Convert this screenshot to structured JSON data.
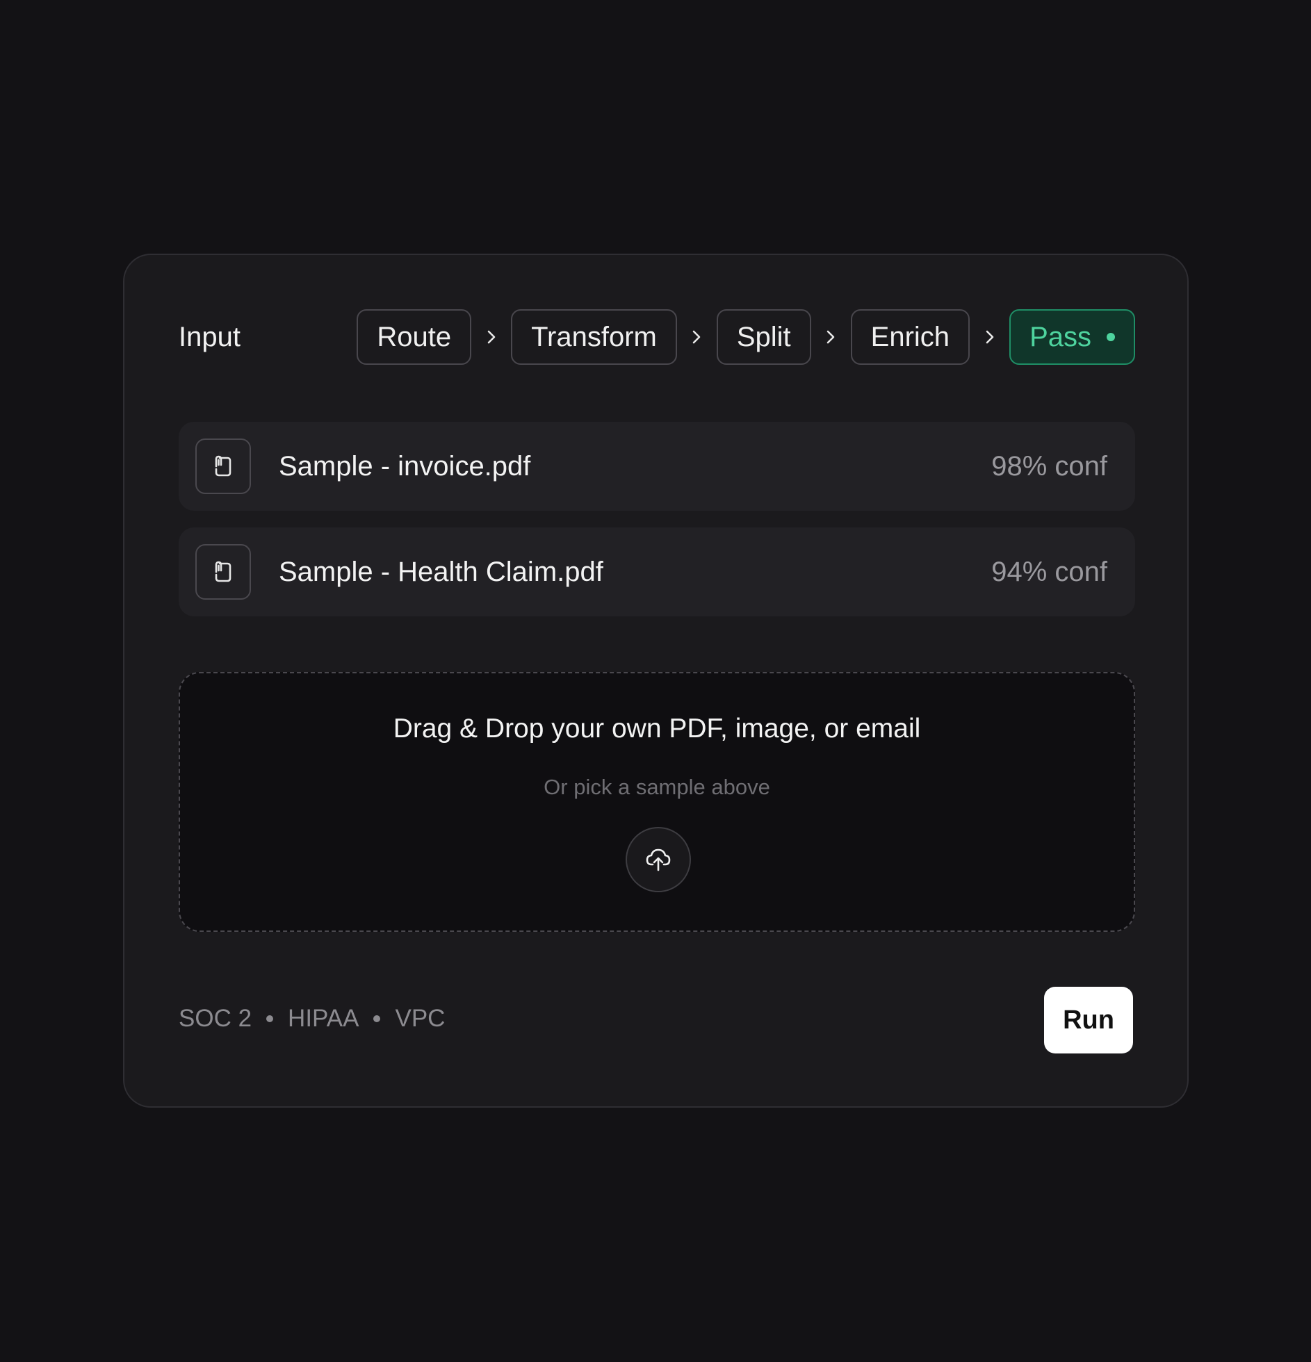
{
  "pipeline": {
    "input_label": "Input",
    "steps": [
      {
        "label": "Route"
      },
      {
        "label": "Transform"
      },
      {
        "label": "Split"
      },
      {
        "label": "Enrich"
      },
      {
        "label": "Pass",
        "status": "active"
      }
    ]
  },
  "samples": [
    {
      "name": "Sample - invoice.pdf",
      "confidence": "98% conf",
      "icon": "document-icon"
    },
    {
      "name": "Sample - Health Claim.pdf",
      "confidence": "94% conf",
      "icon": "document-icon"
    }
  ],
  "dropzone": {
    "title": "Drag & Drop your own PDF, image, or email",
    "subtitle": "Or pick a sample above",
    "icon": "cloud-upload-icon"
  },
  "footer": {
    "compliance": [
      "SOC 2",
      "HIPAA",
      "VPC"
    ],
    "run_label": "Run"
  },
  "colors": {
    "background": "#131215",
    "card": "#1b1a1d",
    "accent_green": "#4ed39e",
    "accent_green_bg": "#10362a"
  }
}
